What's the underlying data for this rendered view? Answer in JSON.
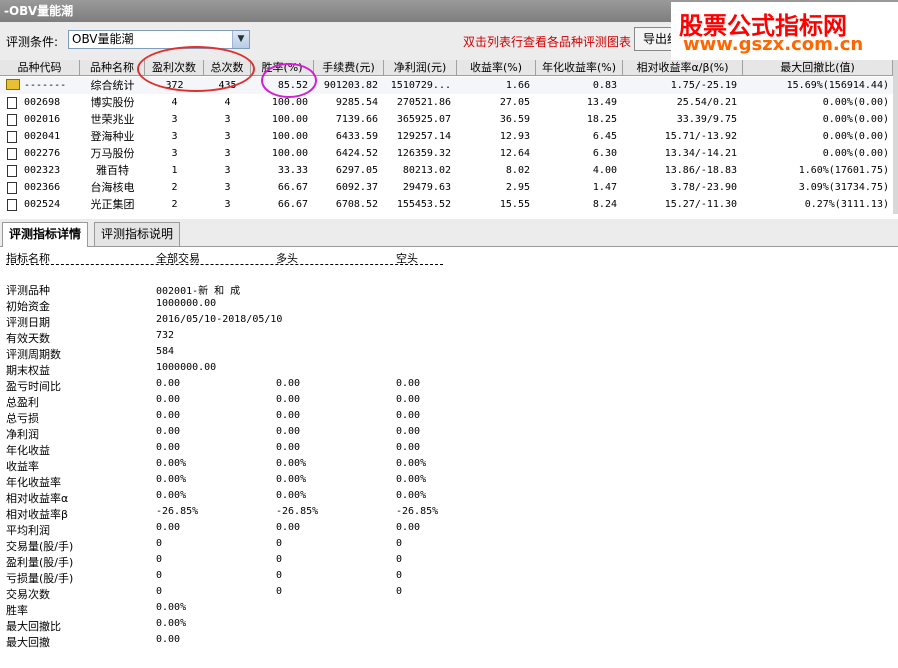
{
  "window": {
    "title": "-OBV量能潮"
  },
  "toolbar": {
    "condition_label": "评测条件:",
    "condition_value": "OBV量能潮",
    "hint": "双击列表行查看各品种评测图表",
    "export_label": "导出结"
  },
  "watermark": {
    "line1": "股票公式指标网",
    "line2": "www.gszx.com.cn"
  },
  "grid": {
    "headers": [
      "品种代码",
      "品种名称",
      "盈利次数",
      "总次数",
      "胜率(%)",
      "手续费(元)",
      "净利润(元)",
      "收益率(%)",
      "年化收益率(%)",
      "相对收益率α/β(%)",
      "最大回撤比(值)"
    ],
    "rows": [
      [
        "-------",
        "综合统计",
        "372",
        "435",
        "85.52",
        "901203.82",
        "1510729...",
        "1.66",
        "0.83",
        "1.75/-25.19",
        "15.69%(156914.44)"
      ],
      [
        "002698",
        "博实股份",
        "4",
        "4",
        "100.00",
        "9285.54",
        "270521.86",
        "27.05",
        "13.49",
        "25.54/0.21",
        "0.00%(0.00)"
      ],
      [
        "002016",
        "世荣兆业",
        "3",
        "3",
        "100.00",
        "7139.66",
        "365925.07",
        "36.59",
        "18.25",
        "33.39/9.75",
        "0.00%(0.00)"
      ],
      [
        "002041",
        "登海种业",
        "3",
        "3",
        "100.00",
        "6433.59",
        "129257.14",
        "12.93",
        "6.45",
        "15.71/-13.92",
        "0.00%(0.00)"
      ],
      [
        "002276",
        "万马股份",
        "3",
        "3",
        "100.00",
        "6424.52",
        "126359.32",
        "12.64",
        "6.30",
        "13.34/-14.21",
        "0.00%(0.00)"
      ],
      [
        "002323",
        "雅百特",
        "1",
        "3",
        "33.33",
        "6297.05",
        "80213.02",
        "8.02",
        "4.00",
        "13.86/-18.83",
        "1.60%(17601.75)"
      ],
      [
        "002366",
        "台海核电",
        "2",
        "3",
        "66.67",
        "6092.37",
        "29479.63",
        "2.95",
        "1.47",
        "3.78/-23.90",
        "3.09%(31734.75)"
      ],
      [
        "002524",
        "光正集团",
        "2",
        "3",
        "66.67",
        "6708.52",
        "155453.52",
        "15.55",
        "8.24",
        "15.27/-11.30",
        "0.27%(3111.13)"
      ]
    ]
  },
  "tabs": [
    {
      "label": "评测指标详情"
    },
    {
      "label": "评测指标说明"
    }
  ],
  "detail": {
    "headers": [
      "指标名称",
      "全部交易",
      "多头",
      "空头"
    ],
    "rows": [
      [
        "评测品种",
        "002001-新 和 成",
        "",
        ""
      ],
      [
        "初始资金",
        "1000000.00",
        "",
        ""
      ],
      [
        "评测日期",
        "2016/05/10-2018/05/10",
        "",
        ""
      ],
      [
        "有效天数",
        "732",
        "",
        ""
      ],
      [
        "评测周期数",
        "584",
        "",
        ""
      ],
      [
        "期末权益",
        "1000000.00",
        "",
        ""
      ],
      [
        "盈亏时间比",
        "0.00",
        "0.00",
        "0.00"
      ],
      [
        "总盈利",
        "0.00",
        "0.00",
        "0.00"
      ],
      [
        "总亏损",
        "0.00",
        "0.00",
        "0.00"
      ],
      [
        "净利润",
        "0.00",
        "0.00",
        "0.00"
      ],
      [
        "年化收益",
        "0.00",
        "0.00",
        "0.00"
      ],
      [
        "收益率",
        "0.00%",
        "0.00%",
        "0.00%"
      ],
      [
        "年化收益率",
        "0.00%",
        "0.00%",
        "0.00%"
      ],
      [
        "相对收益率α",
        "0.00%",
        "0.00%",
        "0.00%"
      ],
      [
        "相对收益率β",
        "-26.85%",
        "-26.85%",
        "-26.85%"
      ],
      [
        "平均利润",
        "0.00",
        "0.00",
        "0.00"
      ],
      [
        "交易量(股/手)",
        "0",
        "0",
        "0"
      ],
      [
        "盈利量(股/手)",
        "0",
        "0",
        "0"
      ],
      [
        "亏损量(股/手)",
        "0",
        "0",
        "0"
      ],
      [
        "交易次数",
        "0",
        "0",
        "0"
      ],
      [
        "胜率",
        "0.00%",
        "",
        ""
      ],
      [
        "最大回撤比",
        "0.00%",
        "",
        ""
      ],
      [
        "最大回撤",
        "0.00",
        "",
        ""
      ]
    ]
  },
  "colors": {
    "hint": "#d40000",
    "watermark_main": "#ff0000",
    "watermark_url": "#ff6600",
    "annotation_red": "#e03030",
    "annotation_magenta": "#d020d0"
  }
}
